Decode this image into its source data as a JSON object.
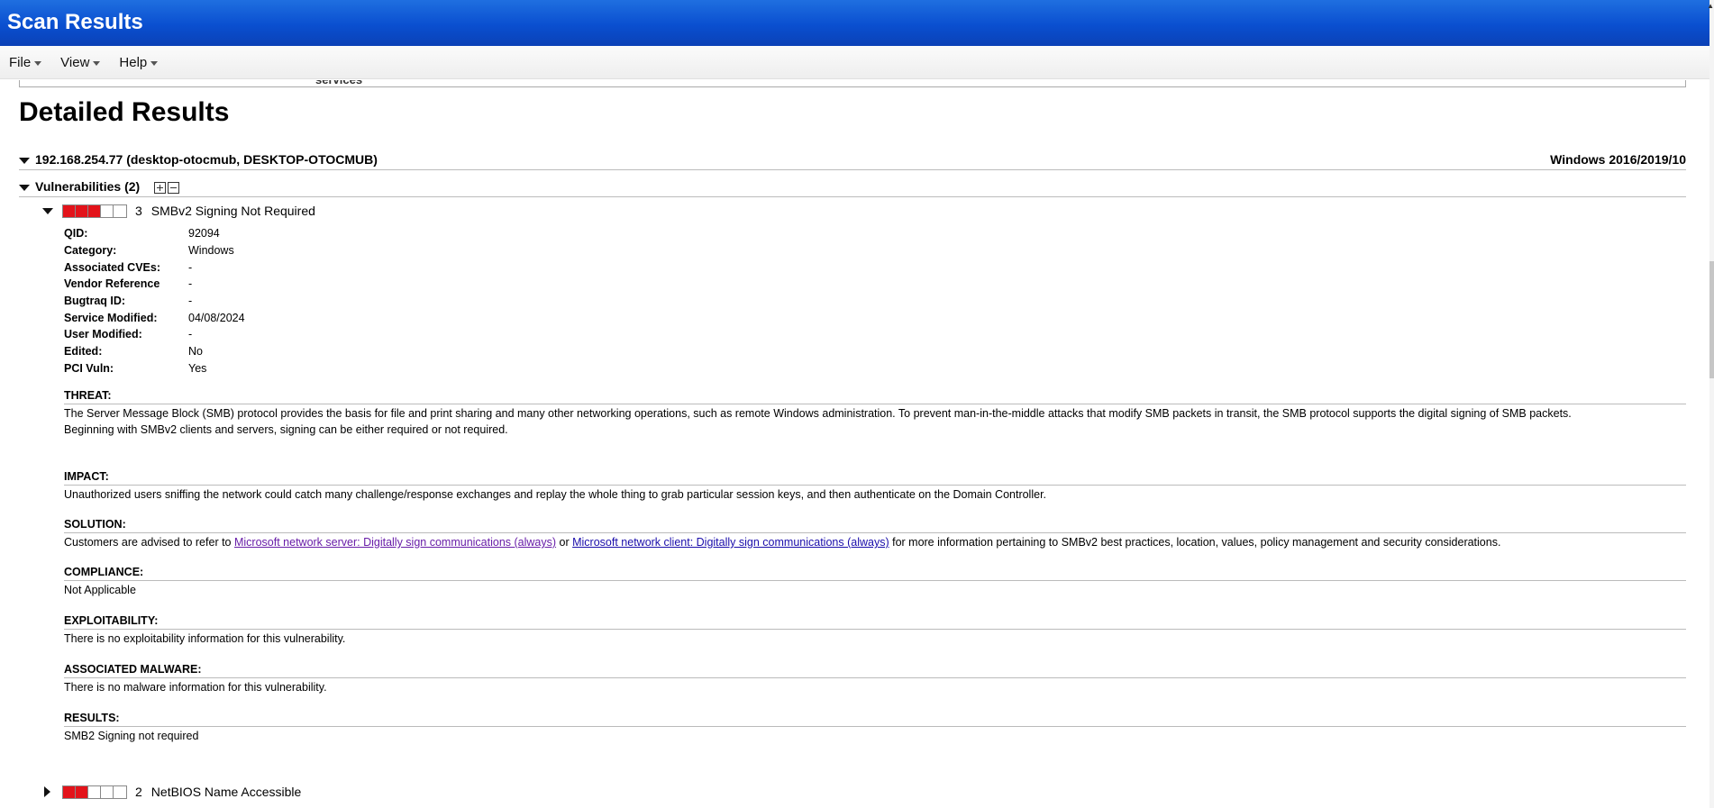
{
  "window": {
    "title": "Scan Results"
  },
  "menu": [
    {
      "label": "File"
    },
    {
      "label": "View"
    },
    {
      "label": "Help"
    }
  ],
  "previous_section": {
    "tail_text": "services"
  },
  "section_title": "Detailed Results",
  "host": {
    "label": "192.168.254.77 (desktop-otocmub, DESKTOP-OTOCMUB)",
    "os": "Windows 2016/2019/10"
  },
  "vulnerabilities": {
    "label": "Vulnerabilities (2)",
    "items": [
      {
        "severity": "3",
        "severity_level": 3,
        "severity_max": 5,
        "title": "SMBv2 Signing Not Required",
        "fields": [
          {
            "key": "QID:",
            "value": "92094"
          },
          {
            "key": "Category:",
            "value": "Windows"
          },
          {
            "key": "Associated CVEs:",
            "value": "-"
          },
          {
            "key": "Vendor Reference",
            "value": "-"
          },
          {
            "key": "Bugtraq ID:",
            "value": "-"
          },
          {
            "key": "Service Modified:",
            "value": "04/08/2024"
          },
          {
            "key": "User Modified:",
            "value": "-"
          },
          {
            "key": "Edited:",
            "value": "No"
          },
          {
            "key": "PCI Vuln:",
            "value": "Yes"
          }
        ],
        "threat": {
          "title": "THREAT:",
          "line1": "The Server Message Block (SMB) protocol provides the basis for file and print sharing and many other networking operations, such as remote Windows administration. To prevent man-in-the-middle attacks that modify SMB packets in transit, the SMB protocol supports the digital signing of SMB packets.",
          "line2": "Beginning with SMBv2 clients and servers, signing can be either required or not required."
        },
        "impact": {
          "title": "IMPACT:",
          "text": "Unauthorized users sniffing the network could catch many challenge/response exchanges and replay the whole thing to grab particular session keys, and then authenticate on the Domain Controller."
        },
        "solution": {
          "title": "SOLUTION:",
          "prefix": "Customers are advised to refer to ",
          "link1": "Microsoft network server: Digitally sign communications (always)",
          "middle": " or ",
          "link2": "Microsoft network client: Digitally sign communications (always)",
          "suffix": " for more information pertaining to SMBv2 best practices, location, values, policy management and security considerations."
        },
        "compliance": {
          "title": "COMPLIANCE:",
          "text": "Not Applicable"
        },
        "exploitability": {
          "title": "EXPLOITABILITY:",
          "text": "There is no exploitability information for this vulnerability."
        },
        "malware": {
          "title": "ASSOCIATED MALWARE:",
          "text": "There is no malware information for this vulnerability."
        },
        "results": {
          "title": "RESULTS:",
          "text": "SMB2 Signing not required"
        }
      },
      {
        "severity": "2",
        "severity_level": 2,
        "severity_max": 5,
        "title": "NetBIOS Name Accessible"
      }
    ]
  },
  "colors": {
    "titlebar": "#0a4fd0",
    "severity_red": "#e3131a"
  }
}
